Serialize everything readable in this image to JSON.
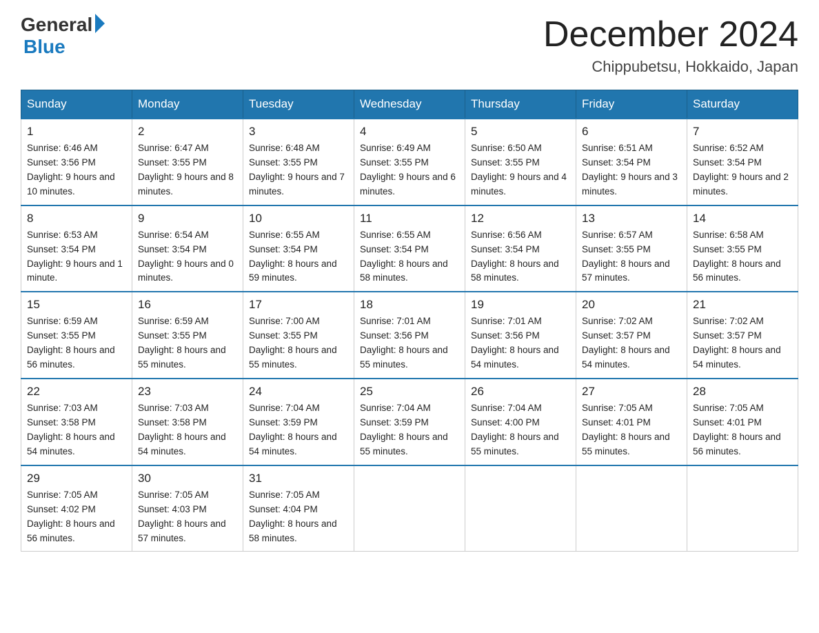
{
  "logo": {
    "general": "General",
    "blue": "Blue"
  },
  "title": "December 2024",
  "location": "Chippubetsu, Hokkaido, Japan",
  "days_of_week": [
    "Sunday",
    "Monday",
    "Tuesday",
    "Wednesday",
    "Thursday",
    "Friday",
    "Saturday"
  ],
  "weeks": [
    [
      {
        "day": "1",
        "sunrise": "6:46 AM",
        "sunset": "3:56 PM",
        "daylight": "9 hours and 10 minutes."
      },
      {
        "day": "2",
        "sunrise": "6:47 AM",
        "sunset": "3:55 PM",
        "daylight": "9 hours and 8 minutes."
      },
      {
        "day": "3",
        "sunrise": "6:48 AM",
        "sunset": "3:55 PM",
        "daylight": "9 hours and 7 minutes."
      },
      {
        "day": "4",
        "sunrise": "6:49 AM",
        "sunset": "3:55 PM",
        "daylight": "9 hours and 6 minutes."
      },
      {
        "day": "5",
        "sunrise": "6:50 AM",
        "sunset": "3:55 PM",
        "daylight": "9 hours and 4 minutes."
      },
      {
        "day": "6",
        "sunrise": "6:51 AM",
        "sunset": "3:54 PM",
        "daylight": "9 hours and 3 minutes."
      },
      {
        "day": "7",
        "sunrise": "6:52 AM",
        "sunset": "3:54 PM",
        "daylight": "9 hours and 2 minutes."
      }
    ],
    [
      {
        "day": "8",
        "sunrise": "6:53 AM",
        "sunset": "3:54 PM",
        "daylight": "9 hours and 1 minute."
      },
      {
        "day": "9",
        "sunrise": "6:54 AM",
        "sunset": "3:54 PM",
        "daylight": "9 hours and 0 minutes."
      },
      {
        "day": "10",
        "sunrise": "6:55 AM",
        "sunset": "3:54 PM",
        "daylight": "8 hours and 59 minutes."
      },
      {
        "day": "11",
        "sunrise": "6:55 AM",
        "sunset": "3:54 PM",
        "daylight": "8 hours and 58 minutes."
      },
      {
        "day": "12",
        "sunrise": "6:56 AM",
        "sunset": "3:54 PM",
        "daylight": "8 hours and 58 minutes."
      },
      {
        "day": "13",
        "sunrise": "6:57 AM",
        "sunset": "3:55 PM",
        "daylight": "8 hours and 57 minutes."
      },
      {
        "day": "14",
        "sunrise": "6:58 AM",
        "sunset": "3:55 PM",
        "daylight": "8 hours and 56 minutes."
      }
    ],
    [
      {
        "day": "15",
        "sunrise": "6:59 AM",
        "sunset": "3:55 PM",
        "daylight": "8 hours and 56 minutes."
      },
      {
        "day": "16",
        "sunrise": "6:59 AM",
        "sunset": "3:55 PM",
        "daylight": "8 hours and 55 minutes."
      },
      {
        "day": "17",
        "sunrise": "7:00 AM",
        "sunset": "3:55 PM",
        "daylight": "8 hours and 55 minutes."
      },
      {
        "day": "18",
        "sunrise": "7:01 AM",
        "sunset": "3:56 PM",
        "daylight": "8 hours and 55 minutes."
      },
      {
        "day": "19",
        "sunrise": "7:01 AM",
        "sunset": "3:56 PM",
        "daylight": "8 hours and 54 minutes."
      },
      {
        "day": "20",
        "sunrise": "7:02 AM",
        "sunset": "3:57 PM",
        "daylight": "8 hours and 54 minutes."
      },
      {
        "day": "21",
        "sunrise": "7:02 AM",
        "sunset": "3:57 PM",
        "daylight": "8 hours and 54 minutes."
      }
    ],
    [
      {
        "day": "22",
        "sunrise": "7:03 AM",
        "sunset": "3:58 PM",
        "daylight": "8 hours and 54 minutes."
      },
      {
        "day": "23",
        "sunrise": "7:03 AM",
        "sunset": "3:58 PM",
        "daylight": "8 hours and 54 minutes."
      },
      {
        "day": "24",
        "sunrise": "7:04 AM",
        "sunset": "3:59 PM",
        "daylight": "8 hours and 54 minutes."
      },
      {
        "day": "25",
        "sunrise": "7:04 AM",
        "sunset": "3:59 PM",
        "daylight": "8 hours and 55 minutes."
      },
      {
        "day": "26",
        "sunrise": "7:04 AM",
        "sunset": "4:00 PM",
        "daylight": "8 hours and 55 minutes."
      },
      {
        "day": "27",
        "sunrise": "7:05 AM",
        "sunset": "4:01 PM",
        "daylight": "8 hours and 55 minutes."
      },
      {
        "day": "28",
        "sunrise": "7:05 AM",
        "sunset": "4:01 PM",
        "daylight": "8 hours and 56 minutes."
      }
    ],
    [
      {
        "day": "29",
        "sunrise": "7:05 AM",
        "sunset": "4:02 PM",
        "daylight": "8 hours and 56 minutes."
      },
      {
        "day": "30",
        "sunrise": "7:05 AM",
        "sunset": "4:03 PM",
        "daylight": "8 hours and 57 minutes."
      },
      {
        "day": "31",
        "sunrise": "7:05 AM",
        "sunset": "4:04 PM",
        "daylight": "8 hours and 58 minutes."
      },
      null,
      null,
      null,
      null
    ]
  ]
}
